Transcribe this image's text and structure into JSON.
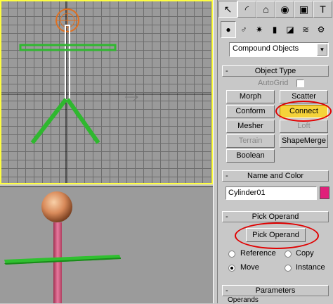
{
  "command_panel": {
    "tabs": [
      {
        "name": "create",
        "glyph": "↖"
      },
      {
        "name": "modify",
        "glyph": "◜"
      },
      {
        "name": "hierarchy",
        "glyph": "⌂"
      },
      {
        "name": "motion",
        "glyph": "◉"
      },
      {
        "name": "display",
        "glyph": "▣"
      },
      {
        "name": "utilities",
        "glyph": "T"
      }
    ],
    "subtabs": [
      {
        "name": "geometry",
        "glyph": "●"
      },
      {
        "name": "shapes",
        "glyph": "♂"
      },
      {
        "name": "lights",
        "glyph": "✷"
      },
      {
        "name": "cameras",
        "glyph": "▮"
      },
      {
        "name": "helpers",
        "glyph": "◪"
      },
      {
        "name": "spacewarps",
        "glyph": "≋"
      },
      {
        "name": "systems",
        "glyph": "⚙"
      }
    ],
    "category_dropdown": "Compound Objects",
    "object_type": {
      "title": "Object Type",
      "sign": "-",
      "autogrid_label": "AutoGrid",
      "buttons": {
        "morph": "Morph",
        "scatter": "Scatter",
        "conform": "Conform",
        "connect": "Connect",
        "mesher": "Mesher",
        "loft": "Loft",
        "terrain": "Terrain",
        "shapemerge": "ShapeMerge",
        "boolean": "Boolean"
      }
    },
    "name_color": {
      "title": "Name and Color",
      "sign": "-",
      "name_value": "Cylinder01",
      "swatch_color": "#e0207a"
    },
    "pick_operand": {
      "title": "Pick Operand",
      "sign": "-",
      "button": "Pick Operand",
      "reference": "Reference",
      "copy": "Copy",
      "move": "Move",
      "instance": "Instance"
    },
    "parameters": {
      "title": "Parameters",
      "sign": "-",
      "operands_label": "Operands"
    }
  },
  "colors": {
    "active_viewport_border": "#ffff40",
    "highlight_button": "#f5d33a",
    "annotation": "#e00000",
    "figure_green": "#2fb82f"
  }
}
